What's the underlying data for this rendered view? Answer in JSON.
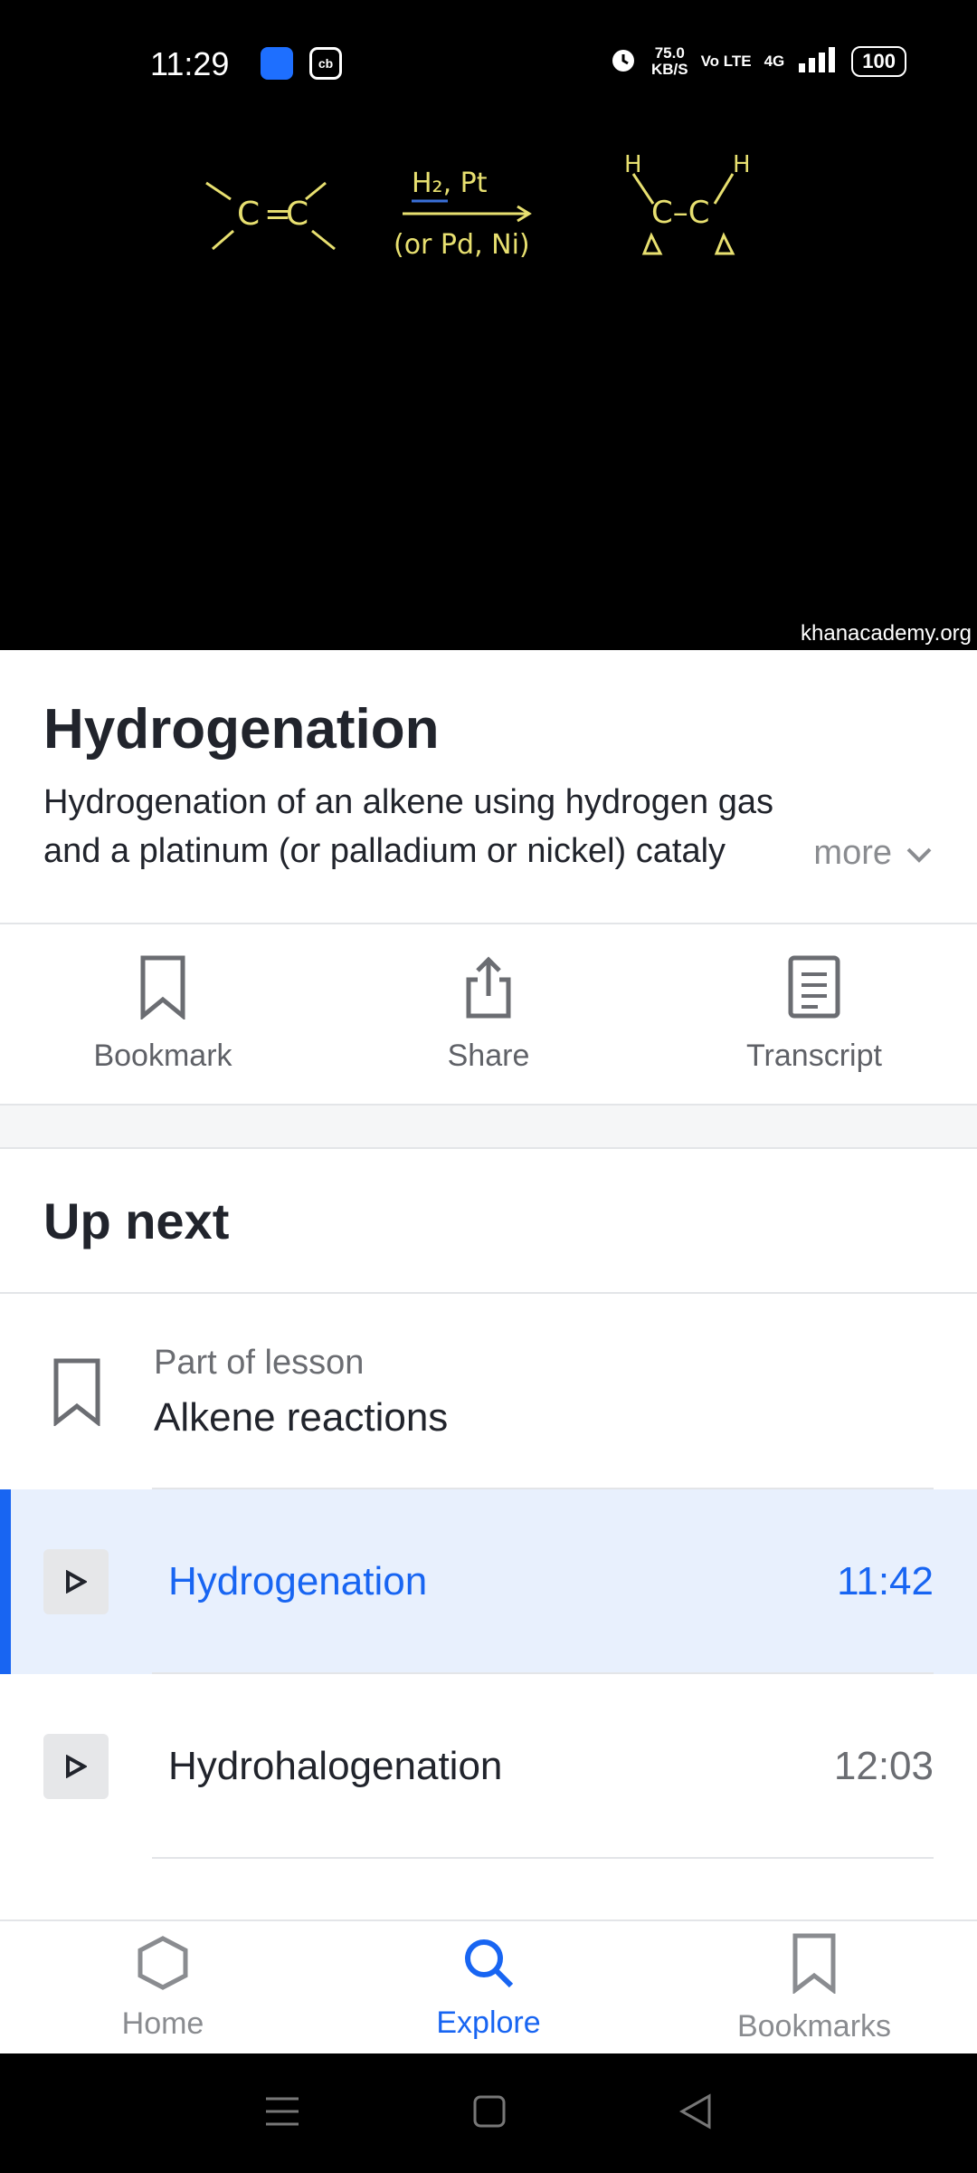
{
  "status": {
    "time": "11:29",
    "speed_value": "75.0",
    "speed_unit": "KB/S",
    "volte": "Vo LTE",
    "network": "4G",
    "battery": "100"
  },
  "video": {
    "watermark": "khanacademy.org",
    "board": {
      "reagent_top": "H₂, Pt",
      "reagent_bottom": "(or Pd, Ni)",
      "h_left": "H",
      "h_right": "H",
      "carbon_left": "C",
      "carbon_right": "C",
      "product_bond": "C–C",
      "bond_eq": "="
    }
  },
  "video_info": {
    "title": "Hydrogenation",
    "description": "Hydrogenation of an alkene using hydrogen gas and a platinum (or palladium or nickel) cataly",
    "more_label": "more"
  },
  "actions": [
    {
      "label": "Bookmark",
      "icon": "bookmark-icon"
    },
    {
      "label": "Share",
      "icon": "share-icon"
    },
    {
      "label": "Transcript",
      "icon": "transcript-icon"
    }
  ],
  "up_next": {
    "title": "Up next",
    "lesson_sub": "Part of lesson",
    "lesson_name": "Alkene reactions",
    "items": [
      {
        "title": "Hydrogenation",
        "duration": "11:42",
        "active": true
      },
      {
        "title": "Hydrohalogenation",
        "duration": "12:03",
        "active": false
      }
    ]
  },
  "nav": [
    {
      "label": "Home",
      "icon": "hexagon-home-icon"
    },
    {
      "label": "Explore",
      "icon": "search-icon",
      "active": true
    },
    {
      "label": "Bookmarks",
      "icon": "bookmark-icon"
    }
  ],
  "colors": {
    "accent": "#1865f2",
    "active_bg": "#e8f0fd",
    "board_chalk": "#e8e070"
  }
}
